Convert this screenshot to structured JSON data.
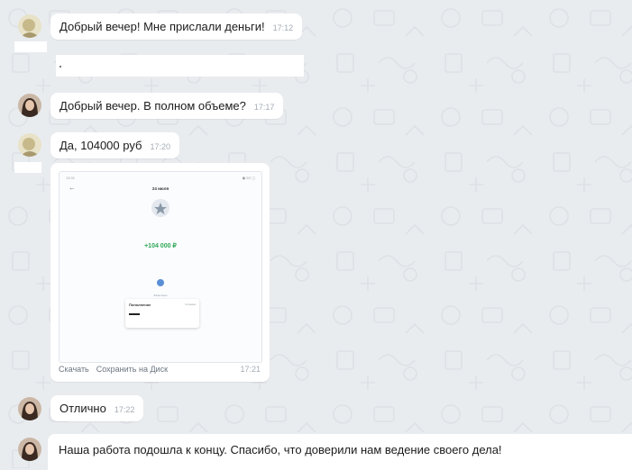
{
  "messages": [
    {
      "text": "Добрый вечер! Мне прислали деньги!",
      "time": "17:12"
    },
    {
      "text": "Добрый вечер. В полном объеме?",
      "time": "17:17"
    },
    {
      "text": "Да, 104000 руб",
      "time": "17:20"
    },
    {
      "text": "Отлично",
      "time": "17:22"
    },
    {
      "text": "Наша работа подошла к концу. Спасибо, что доверили нам ведение своего дела!"
    }
  ],
  "image_message": {
    "actions": {
      "copy": "Скачать",
      "save": "Сохранить на Диск"
    },
    "time": "17:21",
    "screenshot": {
      "status_time": "13:31",
      "status_right": "◼ 5G ◻",
      "date": "24 июля",
      "amount": "+104 000 ₽",
      "button_caption": "Зачислено",
      "card_title": "Пополнение",
      "card_right": "Справка"
    }
  },
  "colors": {
    "background": "#e9ecef",
    "bubble": "#ffffff",
    "time": "#a4acb5",
    "amount_green": "#2fa857"
  }
}
